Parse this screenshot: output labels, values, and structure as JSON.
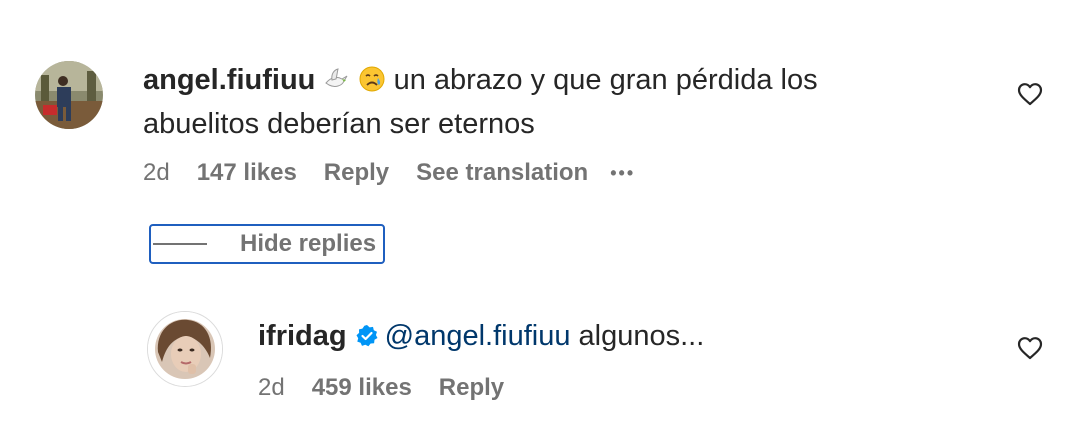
{
  "comment": {
    "username": "angel.fiufiuu",
    "emoji_icons": [
      "dove-icon",
      "crying-face-icon"
    ],
    "text_line1": "un abrazo y que gran pérdida los",
    "text_line2": "abuelitos deberían ser eternos",
    "time": "2d",
    "likes": "147 likes",
    "reply_label": "Reply",
    "translate_label": "See translation",
    "more_label": "•••"
  },
  "replies_toggle": {
    "label": "Hide replies"
  },
  "reply": {
    "username": "ifridag",
    "verified": true,
    "mention": "@angel.fiufiuu",
    "text": "algunos...",
    "time": "2d",
    "likes": "459 likes",
    "reply_label": "Reply"
  },
  "colors": {
    "text": "#262626",
    "secondary": "#737373",
    "mention": "#00376b",
    "verified": "#0095f6",
    "focus_ring": "#1f5fbf"
  }
}
